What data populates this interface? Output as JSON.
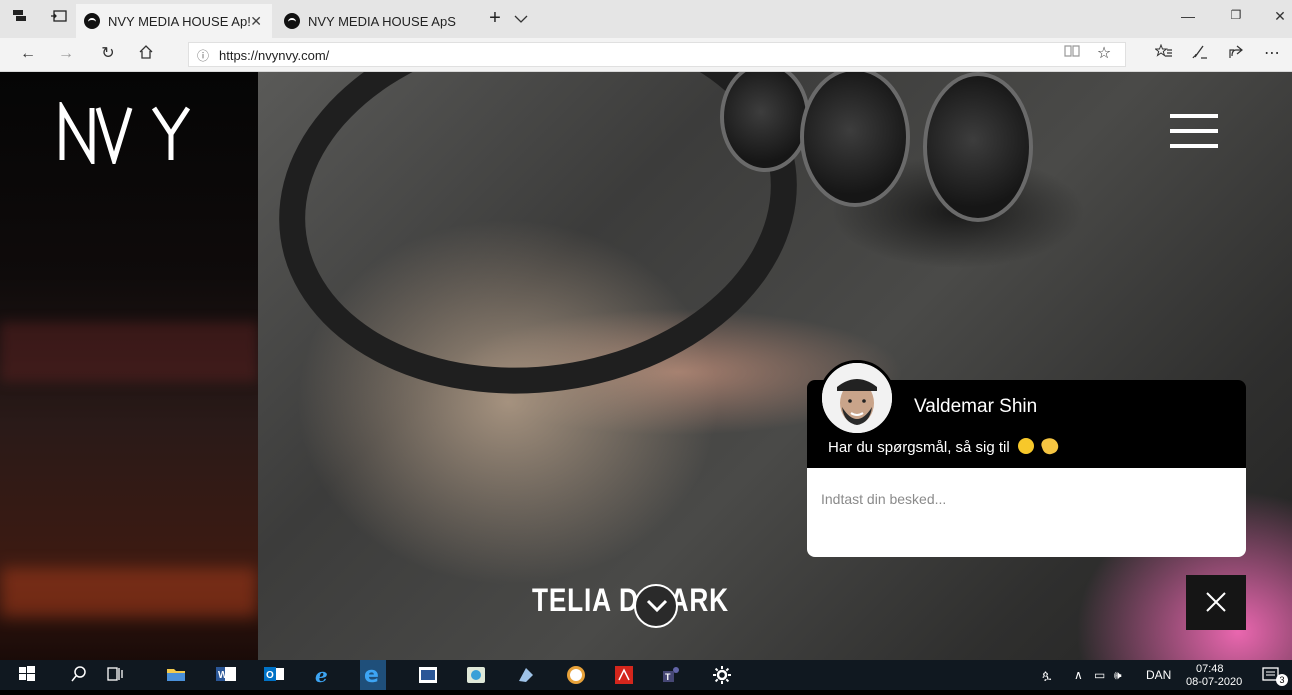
{
  "browser": {
    "tabs": [
      {
        "title": "NVY MEDIA HOUSE Ap!",
        "active": true
      },
      {
        "title": "NVY MEDIA HOUSE ApS",
        "active": false
      }
    ],
    "address": {
      "url": "https://nvynvy.com/"
    }
  },
  "page": {
    "logo_text": "NVY",
    "brand_banner": "TELIA D  MARK",
    "chat": {
      "agent_name": "Valdemar Shin",
      "greeting": "Har du spørgsmål, så sig til",
      "input_placeholder": "Indtast din besked..."
    }
  },
  "taskbar": {
    "language": "DAN",
    "time": "07:48",
    "date": "08-07-2020",
    "notifications": "3"
  },
  "colors": {
    "chat_header": "#000000",
    "taskbar": "#101820",
    "tabbar": "#e5e5e5"
  }
}
